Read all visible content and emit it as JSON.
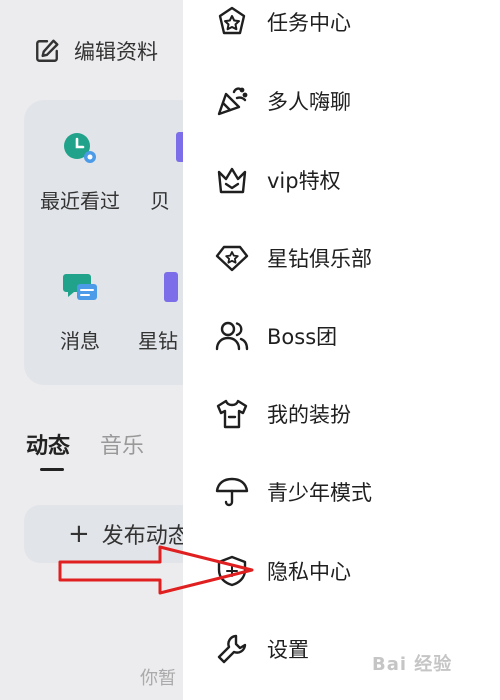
{
  "background": {
    "edit_profile_label": "编辑资料",
    "quick_items": [
      {
        "label": "最近看过",
        "icon": "clock-icon",
        "color": "#20a38a"
      },
      {
        "label": "贝",
        "icon": "partial-icon",
        "color": "#7b6ee8"
      },
      {
        "label": "消息",
        "icon": "chat-icon",
        "color": "#20a38a"
      },
      {
        "label": "星钻",
        "icon": "partial-icon",
        "color": "#7b6ee8"
      }
    ],
    "tabs": [
      {
        "label": "动态",
        "active": true
      },
      {
        "label": "音乐",
        "active": false
      }
    ],
    "post_button_label": "发布动态",
    "empty_hint": "你暂"
  },
  "drawer": {
    "items": [
      {
        "label": "任务中心",
        "icon": "task-star-icon"
      },
      {
        "label": "多人嗨聊",
        "icon": "party-popper-icon"
      },
      {
        "label": "vip特权",
        "icon": "crown-icon"
      },
      {
        "label": "星钻俱乐部",
        "icon": "diamond-star-icon"
      },
      {
        "label": "Boss团",
        "icon": "users-icon"
      },
      {
        "label": "我的装扮",
        "icon": "tshirt-icon"
      },
      {
        "label": "青少年模式",
        "icon": "umbrella-icon"
      },
      {
        "label": "隐私中心",
        "icon": "shield-icon"
      },
      {
        "label": "设置",
        "icon": "wrench-icon"
      }
    ]
  },
  "annotation": {
    "arrow_color": "#e02020",
    "target": "隐私中心"
  },
  "watermark": "Bai 经验"
}
